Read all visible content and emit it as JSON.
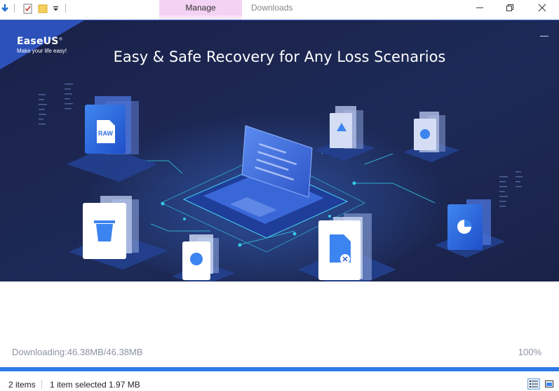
{
  "explorer": {
    "ribbon_tab_manage": "Manage",
    "ribbon_tab_downloads": "Downloads",
    "quick_access_icons": [
      "download-arrow-icon",
      "properties-check-icon",
      "new-folder-icon",
      "customize-dropdown-icon"
    ],
    "window_controls": {
      "minimize": "—",
      "maximize": "❐",
      "close": "✕"
    }
  },
  "installer": {
    "brand": "EaseUS",
    "brand_mark": "®",
    "tagline": "Make your life easy!",
    "headline": "Easy & Safe Recovery for Any Loss Scenarios",
    "tile_labels": {
      "raw": "RAW"
    },
    "download_status": "Downloading:46.38MB/46.38MB",
    "percent_text": "100%",
    "progress_fraction": 1.0,
    "colors": {
      "banner_bg": "#1b2346",
      "accent": "#2d7be8",
      "tile_blue": "#2f6fe0",
      "line_cyan": "#35c8e8"
    }
  },
  "statusbar": {
    "item_count": "2 items",
    "selection": "1 item selected  1.97 MB",
    "view_icons": [
      "details-view-icon",
      "large-icons-view-icon"
    ]
  }
}
